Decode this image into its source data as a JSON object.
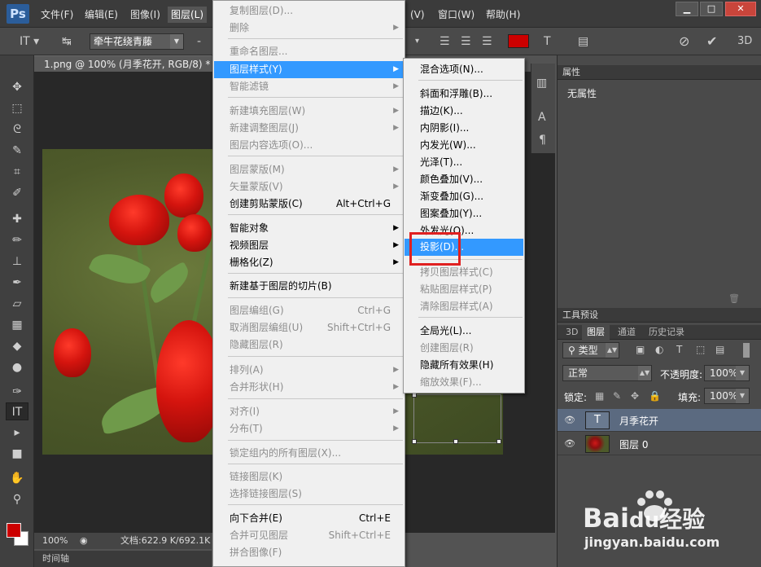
{
  "app": {
    "logo": "Ps"
  },
  "menubar": {
    "items": [
      "文件(F)",
      "编辑(E)",
      "图像(I)",
      "图层(L)"
    ],
    "items_right": [
      "(V)",
      "窗口(W)",
      "帮助(H)"
    ],
    "window_buttons": [
      "▁",
      "□",
      "✕"
    ]
  },
  "options": {
    "font": "牵牛花绕青藤",
    "color": "#cc0000"
  },
  "document": {
    "tab_title": "1.png @ 100% (月季花开, RGB/8) *",
    "tab_close": "×",
    "zoom": "100%",
    "doc_size": "文档:622.9 K/692.1K",
    "timeline": "时间轴"
  },
  "layer_menu": {
    "items": [
      {
        "label": "复制图层(D)...",
        "disabled": true
      },
      {
        "label": "删除",
        "disabled": true,
        "submenu": true
      },
      {
        "label": "重命名图层...",
        "disabled": true
      },
      {
        "label": "图层样式(Y)",
        "highlight": true,
        "submenu": true
      },
      {
        "label": "智能滤镜",
        "disabled": true,
        "submenu": true
      },
      {
        "label": "新建填充图层(W)",
        "disabled": true,
        "submenu": true
      },
      {
        "label": "新建调整图层(J)",
        "disabled": true,
        "submenu": true
      },
      {
        "label": "图层内容选项(O)...",
        "disabled": true
      },
      {
        "label": "图层蒙版(M)",
        "disabled": true,
        "submenu": true
      },
      {
        "label": "矢量蒙版(V)",
        "disabled": true,
        "submenu": true
      },
      {
        "label": "创建剪贴蒙版(C)",
        "shortcut": "Alt+Ctrl+G"
      },
      {
        "label": "智能对象",
        "submenu": true
      },
      {
        "label": "视频图层",
        "submenu": true
      },
      {
        "label": "栅格化(Z)",
        "submenu": true
      },
      {
        "label": "新建基于图层的切片(B)"
      },
      {
        "label": "图层编组(G)",
        "disabled": true,
        "shortcut": "Ctrl+G"
      },
      {
        "label": "取消图层编组(U)",
        "disabled": true,
        "shortcut": "Shift+Ctrl+G"
      },
      {
        "label": "隐藏图层(R)",
        "disabled": true
      },
      {
        "label": "排列(A)",
        "disabled": true,
        "submenu": true
      },
      {
        "label": "合并形状(H)",
        "disabled": true,
        "submenu": true
      },
      {
        "label": "对齐(I)",
        "disabled": true,
        "submenu": true
      },
      {
        "label": "分布(T)",
        "disabled": true,
        "submenu": true
      },
      {
        "label": "锁定组内的所有图层(X)...",
        "disabled": true
      },
      {
        "label": "链接图层(K)",
        "disabled": true
      },
      {
        "label": "选择链接图层(S)",
        "disabled": true
      },
      {
        "label": "向下合并(E)",
        "shortcut": "Ctrl+E"
      },
      {
        "label": "合并可见图层",
        "disabled": true,
        "shortcut": "Shift+Ctrl+E"
      },
      {
        "label": "拼合图像(F)",
        "disabled": true
      }
    ]
  },
  "style_menu": {
    "items": [
      {
        "label": "混合选项(N)..."
      },
      {
        "label": "斜面和浮雕(B)..."
      },
      {
        "label": "描边(K)..."
      },
      {
        "label": "内阴影(I)..."
      },
      {
        "label": "内发光(W)..."
      },
      {
        "label": "光泽(T)..."
      },
      {
        "label": "颜色叠加(V)..."
      },
      {
        "label": "渐变叠加(G)..."
      },
      {
        "label": "图案叠加(Y)..."
      },
      {
        "label": "外发光(O)..."
      },
      {
        "label": "投影(D)...",
        "highlight": true
      },
      {
        "label": "拷贝图层样式(C)",
        "disabled": true
      },
      {
        "label": "粘贴图层样式(P)",
        "disabled": true
      },
      {
        "label": "清除图层样式(A)",
        "disabled": true
      },
      {
        "label": "全局光(L)..."
      },
      {
        "label": "创建图层(R)",
        "disabled": true
      },
      {
        "label": "隐藏所有效果(H)"
      },
      {
        "label": "缩放效果(F)...",
        "disabled": true
      }
    ]
  },
  "properties_panel": {
    "title": "属性",
    "content": "无属性"
  },
  "tool_preset_panel": {
    "title": "工具预设"
  },
  "layers_panel": {
    "tabs": [
      "3D",
      "图层",
      "通道",
      "历史记录"
    ],
    "filter": "类型",
    "blend_mode": "正常",
    "opacity_label": "不透明度:",
    "opacity": "100%",
    "lock_label": "锁定:",
    "fill_label": "填充:",
    "fill": "100%",
    "layers": [
      {
        "name": "月季花开",
        "type": "text",
        "selected": true
      },
      {
        "name": "图层 0",
        "type": "image",
        "selected": false
      }
    ]
  },
  "watermark": {
    "brand": "Bai",
    "brand2": "du",
    "cn": "经验",
    "url": "jingyan.baidu.com"
  }
}
